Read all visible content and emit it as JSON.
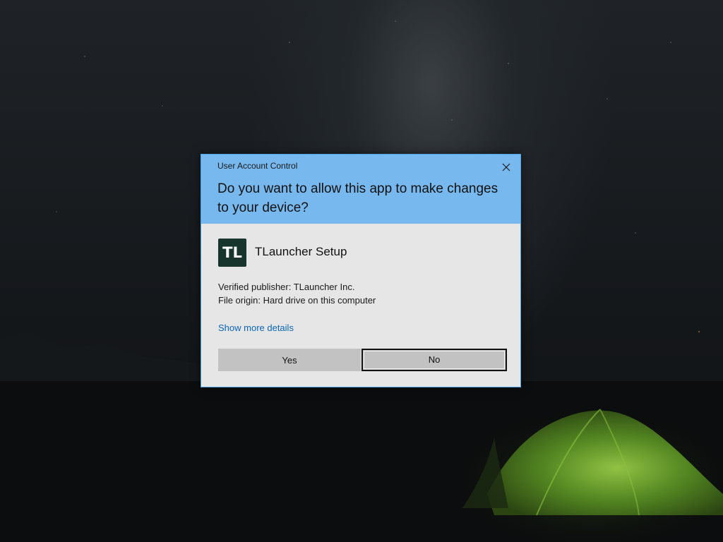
{
  "dialog": {
    "title": "User Account Control",
    "question": "Do you want to allow this app to make changes to your device?",
    "close_icon": "close-icon"
  },
  "app": {
    "icon_text": "TL",
    "icon_color": "#17352c",
    "name": "TLauncher Setup"
  },
  "info": {
    "publisher": "Verified publisher: TLauncher Inc.",
    "origin": "File origin: Hard drive on this computer"
  },
  "details_link": "Show more details",
  "buttons": {
    "yes": "Yes",
    "no": "No"
  },
  "colors": {
    "header": "#77b8ee",
    "body": "#e6e6e6",
    "link": "#0a66b7",
    "tent": "#5a8a2a"
  }
}
